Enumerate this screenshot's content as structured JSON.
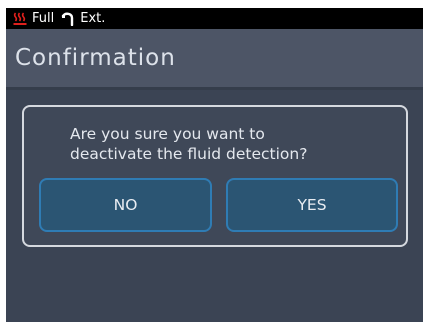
{
  "status_bar": {
    "heater_icon": "heater-icon",
    "mode_label": "Full",
    "hook_icon": "hook-icon",
    "extension_label": "Ext."
  },
  "header": {
    "title": "Confirmation"
  },
  "dialog": {
    "message_line1": "Are you sure you want to",
    "message_line2": "deactivate the fluid detection?",
    "no_label": "NO",
    "yes_label": "YES"
  },
  "colors": {
    "status_bar_bg": "#000000",
    "header_bg": "#4d5566",
    "screen_bg": "#3b4454",
    "heater_icon": "#e0201c",
    "button_bg": "#2b5573",
    "button_border": "#2f7cb4",
    "dialog_border": "#d5d9df"
  }
}
